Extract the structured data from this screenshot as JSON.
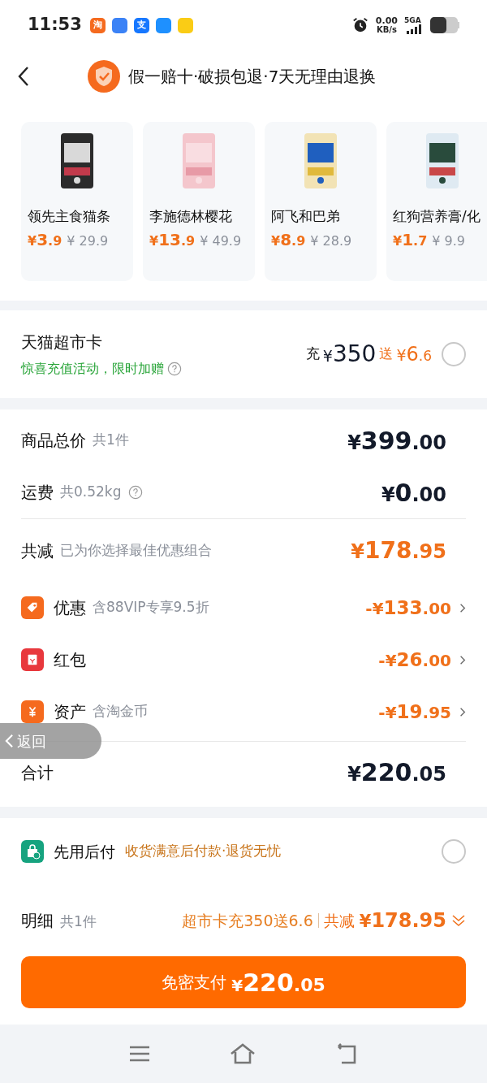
{
  "status_bar": {
    "time": "11:53",
    "app_icons": [
      {
        "kind": "text",
        "label": "淘"
      },
      {
        "kind": "logo"
      },
      {
        "kind": "text",
        "label": "支"
      },
      {
        "kind": "logo"
      },
      {
        "kind": "logo"
      }
    ],
    "net_speed": "0.00",
    "net_unit": "KB/s",
    "network": "5GA"
  },
  "header": {
    "title": "假一赔十·破损包退·7天无理由退换"
  },
  "products": [
    {
      "name": "领先主食猫条",
      "price": "¥3.9",
      "original_price": "¥ 29.9"
    },
    {
      "name": "李施德林樱花",
      "price": "¥13.9",
      "original_price": "¥ 49.9"
    },
    {
      "name": "阿飞和巴弟",
      "price": "¥8.9",
      "original_price": "¥ 28.9"
    },
    {
      "name": "红狗营养膏/化",
      "price": "¥1.7",
      "original_price": "¥ 9.9"
    }
  ],
  "card_offer": {
    "title": "天猫超市卡",
    "subtitle": "惊喜充值活动，限时加赠",
    "recharge_label": "充",
    "recharge_amount": "¥350",
    "bonus_label": "送",
    "bonus_amount": "¥6.6",
    "selected": false
  },
  "summary": {
    "rows": [
      {
        "kind": "plain",
        "label": "商品总价",
        "note": "共1件",
        "amount": "¥399.00"
      },
      {
        "kind": "plain",
        "label": "运费",
        "note": "共0.52kg",
        "amount": "¥0.00",
        "help": true
      },
      {
        "kind": "discount_total",
        "label": "共减",
        "note": "已为你选择最佳优惠组合",
        "amount": "¥178.95"
      },
      {
        "kind": "discount",
        "label": "优惠",
        "note": "含88VIP专享9.5折",
        "amount": "-¥133.00"
      },
      {
        "kind": "discount",
        "label": "红包",
        "amount": "-¥26.00"
      },
      {
        "kind": "discount",
        "label": "资产",
        "note": "含淘金币",
        "amount": "-¥19.95"
      },
      {
        "kind": "total",
        "label": "合计",
        "amount": "¥220.05"
      }
    ]
  },
  "back_overlay": {
    "label": "返回"
  },
  "pay_later": {
    "title": "先用后付",
    "subtitle": "收货满意后付款·退货无忧",
    "selected": false
  },
  "detail": {
    "label": "明细",
    "count": "共1件",
    "promo": "超市卡充350送6.6",
    "reduction_label": "共减",
    "reduction": "¥178.95"
  },
  "pay_button": {
    "label": "免密支付",
    "amount": "¥220.05"
  }
}
